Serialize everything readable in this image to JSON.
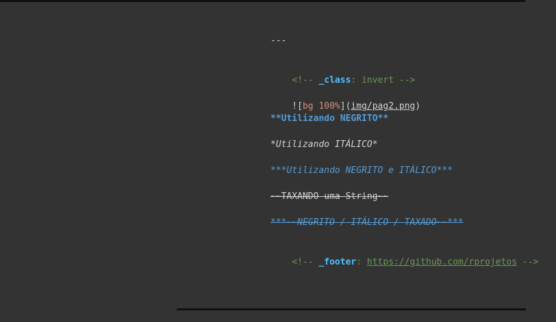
{
  "editor": {
    "hr": "---",
    "class_comment": {
      "open": "<!-- ",
      "key": "_class",
      "sep": ": ",
      "value": "invert",
      "close": " -->"
    },
    "image_line": {
      "prefix": "![",
      "alt": "bg 100%",
      "middle": "](",
      "path": "img/pag2.png",
      "suffix": ")"
    },
    "bold_line": "**Utilizando NEGRITO**",
    "italic_line": "*Utilizando ITÁLICO*",
    "bolditalic_line": "***Utilizando NEGRITO e ITÁLICO***",
    "strike_line": "~~TAXANDO uma String~~",
    "combo_line": "***~~NEGRITO / ITÁLICO / TAXADO~~***",
    "footer_comment": {
      "open": "<!-- ",
      "key": "_footer",
      "sep": ": ",
      "url": "https://github.com/rprojetos",
      "close": " -->"
    }
  },
  "colors": {
    "background": "#333333",
    "comment": "#6a9955",
    "bold": "#569cd6",
    "attr": "#ce9178",
    "text": "#d4d4d4"
  }
}
